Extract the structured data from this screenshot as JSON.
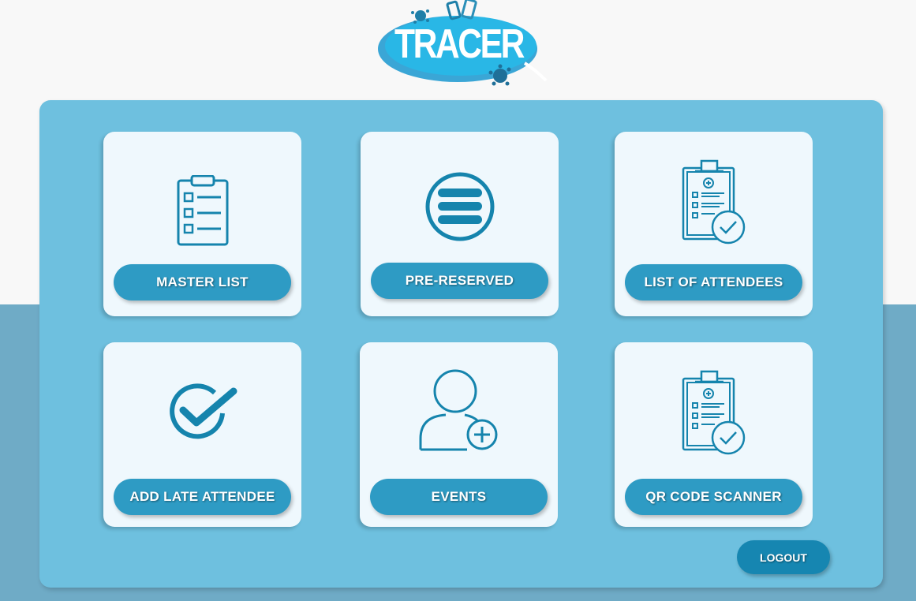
{
  "app": {
    "logo_text": "TRACER",
    "colors": {
      "accent": "#2e9bc4",
      "panel": "#6ec0df",
      "icon": "#1584ad",
      "logout": "#1686b1"
    }
  },
  "menu": {
    "cards": [
      {
        "label": "MASTER LIST",
        "icon": "clipboard-checklist-icon"
      },
      {
        "label": "PRE-RESERVED",
        "icon": "menu-lines-icon"
      },
      {
        "label": "LIST OF ATTENDEES",
        "icon": "medical-clipboard-check-icon"
      },
      {
        "label": "ADD LATE ATTENDEE",
        "icon": "check-circle-icon"
      },
      {
        "label": "EVENTS",
        "icon": "user-add-icon"
      },
      {
        "label": "QR CODE SCANNER",
        "icon": "medical-clipboard-check-icon"
      }
    ]
  },
  "logout_label": "LOGOUT"
}
